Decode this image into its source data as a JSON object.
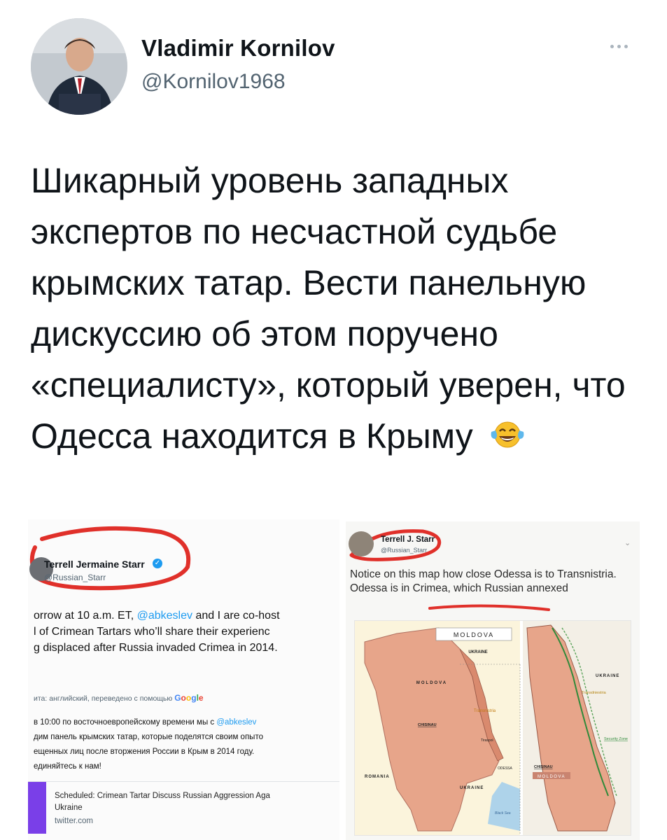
{
  "tweet": {
    "author_name": "Vladimir Kornilov",
    "author_handle": "@Kornilov1968",
    "text": "Шикарный уровень западных экспертов по несчастной судьбе крымских татар. Вести панельную дискуссию об этом поручено «специалисту», который уверен, что Одесса находится в Крыму"
  },
  "embedded_left": {
    "author_name": "Terrell Jermaine Starr",
    "author_handle": "@Russian_Starr",
    "body_lines": [
      "orrow at 10 a.m. ET, ",
      "@abkeslev",
      " and I are co-host",
      "l of Crimean Tartars who’ll share their experienc",
      "g displaced after Russia invaded Crimea in 2014."
    ],
    "translate_label": "ита: английский, переведено с помощью",
    "translate_brand": "Google",
    "ru_lines": [
      "в 10:00 по восточноевропейскому времени мы с ",
      "@abkeslev",
      "дим панель крымских татар, которые поделятся своим опыто",
      "ещенных лиц после вторжения России в Крым в 2014 году.",
      "единяйтесь к нам!"
    ],
    "card_title": "Scheduled: Crimean Tartar Discuss Russian Aggression Aga",
    "card_subtitle": "Ukraine",
    "card_url": "twitter.com"
  },
  "embedded_right": {
    "author_name": "Terrell J. Starr",
    "author_handle": "@Russian_Starr",
    "body": "Notice on this map how close Odessa is to Transnistria. Odessa is in Crimea, which Russian annexed",
    "map_labels": {
      "moldova_top": "MOLDOVA",
      "ukraine_top": "UKRAINE",
      "moldova_mid": "MOLDOVA",
      "romania": "ROMANIA",
      "ukraine_bottom": "UKRAINE",
      "transnistria": "Transnistria",
      "chisinau": "CHISINAU",
      "black_sea": "Black Sea",
      "odessa": "ODESSA",
      "tiraspol": "Tiraspol",
      "ukraine_right": "UKRAINE",
      "transnistria_right": "Transdniestria",
      "security_zone": "Security Zone",
      "chisinau_right": "CHISINAU",
      "moldova_right": "MOLDOVA"
    }
  }
}
